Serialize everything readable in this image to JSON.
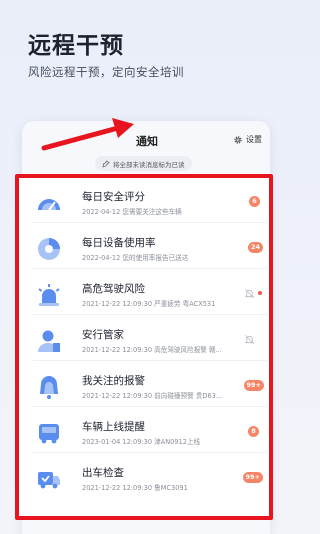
{
  "hero": {
    "title": "远程干预",
    "subtitle": "风险远程干预，定向安全培训"
  },
  "panel": {
    "title": "通知",
    "settings_label": "设置",
    "mark_all_read": "将全部未读消息标为已读"
  },
  "colors": {
    "highlight_border": "#e8151e",
    "badge": "#f58567",
    "unread_dot": "#f05a4a",
    "icon_blue": "#5b8def"
  },
  "notifications": [
    {
      "title": "每日安全评分",
      "desc": "2022-04-12 您需要关注这些车辆",
      "badge": "6",
      "icon": "gauge-icon"
    },
    {
      "title": "每日设备使用率",
      "desc": "2022-04-12 您的使用率报告已送达",
      "badge": "24",
      "icon": "pie-chart-icon"
    },
    {
      "title": "高危驾驶风险",
      "desc": "2021-12-22 12:09:30 严重疲劳 粤ACX531",
      "badge": "",
      "muted": true,
      "unread": true,
      "icon": "siren-icon"
    },
    {
      "title": "安行管家",
      "desc": "2021-12-22 12:09:30 高危驾驶风险报警 赣...",
      "badge": "",
      "muted": true,
      "unread": false,
      "icon": "person-icon"
    },
    {
      "title": "我关注的报警",
      "desc": "2021-12-22 12:09:30 前向碰撞预警 贵D63...",
      "badge": "99+",
      "icon": "alarm-bell-icon"
    },
    {
      "title": "车辆上线提醒",
      "desc": "2023-01-04 12:09:30 津AN0912上线",
      "badge": "8",
      "icon": "bus-icon"
    },
    {
      "title": "出车检查",
      "desc": "2021-12-22 12:09:30 鲁MC3091",
      "badge": "99+",
      "icon": "truck-check-icon"
    }
  ]
}
